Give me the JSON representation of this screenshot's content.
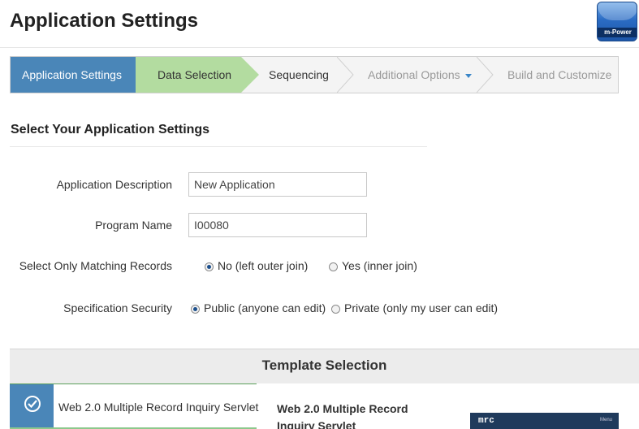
{
  "header": {
    "title": "Application Settings",
    "logo_text": "m-Power"
  },
  "wizard": {
    "steps": [
      {
        "label": "Application Settings",
        "state": "active"
      },
      {
        "label": "Data Selection",
        "state": "completed"
      },
      {
        "label": "Sequencing",
        "state": "available"
      },
      {
        "label": "Additional Options",
        "state": "disabled"
      },
      {
        "label": "Build and Customize",
        "state": "disabled"
      }
    ]
  },
  "form": {
    "section_title": "Select Your Application Settings",
    "description_label": "Application Description",
    "description_value": "New Application",
    "program_label": "Program Name",
    "program_value": "I00080",
    "matching_label": "Select Only Matching Records",
    "matching_options": [
      "No (left outer join)",
      "Yes (inner join)"
    ],
    "matching_selected": 0,
    "security_label": "Specification Security",
    "security_options": [
      "Public (anyone can edit)",
      "Private (only my user can edit)"
    ],
    "security_selected": 0
  },
  "templates": {
    "header": "Template Selection",
    "selected_item": "Web 2.0 Multiple Record Inquiry Servlet",
    "detail_title": "Web 2.0 Multiple Record Inquiry Servlet",
    "preview_label": "mrc",
    "preview_menu": "Menu"
  },
  "colors": {
    "active_step": "#4a86b8",
    "completed_step": "#b3dca0",
    "accent": "#3a86c8"
  }
}
